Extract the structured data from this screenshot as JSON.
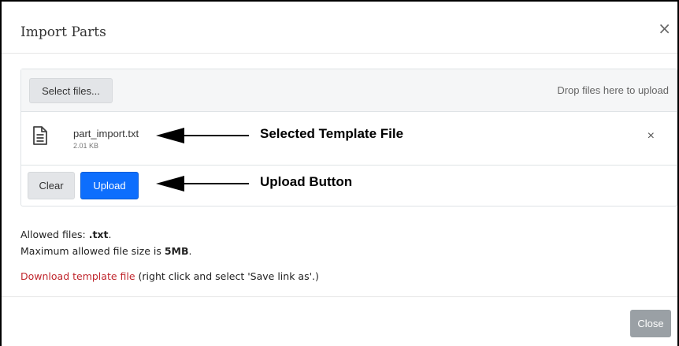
{
  "dialog": {
    "title": "Import Parts",
    "close_icon": "×"
  },
  "upload": {
    "select_label": "Select files...",
    "drop_hint": "Drop files here to upload",
    "file": {
      "name": "part_import.txt",
      "size": "2.01 KB",
      "remove_icon": "×",
      "icon": "document-icon"
    },
    "clear_label": "Clear",
    "upload_label": "Upload"
  },
  "annotations": {
    "file_label": "Selected Template File",
    "upload_label": "Upload Button"
  },
  "info": {
    "allowed_prefix": "Allowed files: ",
    "allowed_value": ".txt",
    "allowed_suffix": ".",
    "max_prefix": "Maximum allowed file size is ",
    "max_value": "5MB",
    "max_suffix": ".",
    "download_link": "Download template file",
    "download_note": " (right click and select 'Save link as'.)"
  },
  "footer": {
    "close_label": "Close"
  },
  "colors": {
    "primary": "#0d6efd",
    "link": "#c0262d",
    "close_button": "#9aa0a5"
  }
}
